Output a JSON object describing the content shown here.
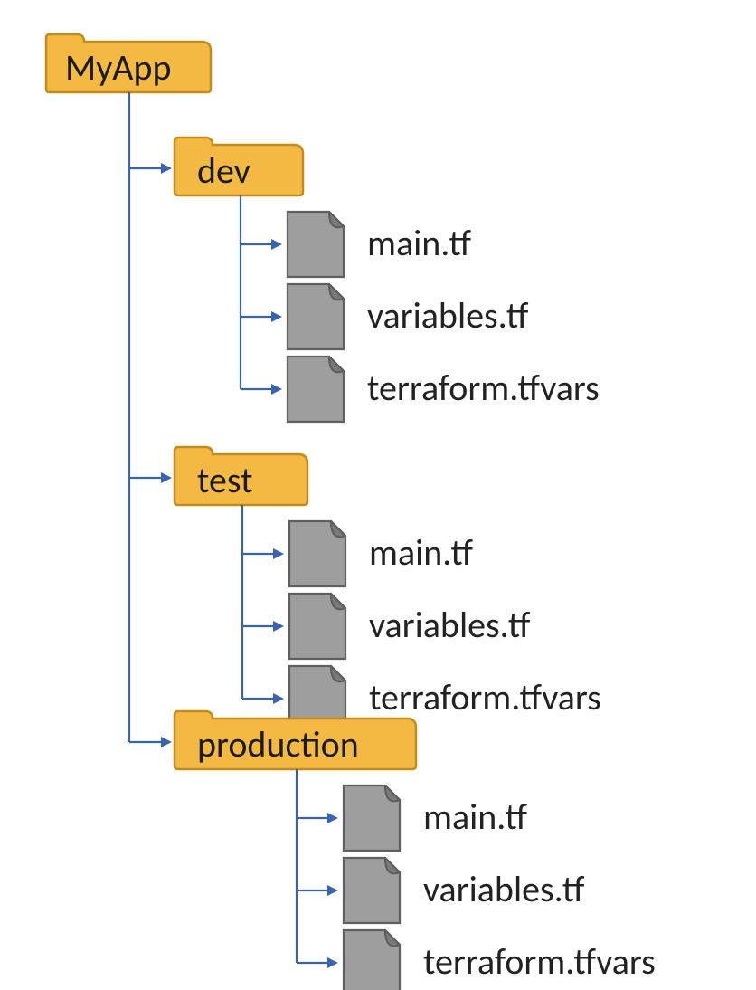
{
  "colors": {
    "folder_fill": "#f4b942",
    "folder_stroke": "#c38b1a",
    "connector": "#3a62b3"
  },
  "tree": {
    "root": {
      "label": "MyApp",
      "type": "folder"
    },
    "children": [
      {
        "label": "dev",
        "type": "folder",
        "files": [
          {
            "label": "main.tf"
          },
          {
            "label": "variables.tf"
          },
          {
            "label": "terraform.tfvars"
          }
        ]
      },
      {
        "label": "test",
        "type": "folder",
        "files": [
          {
            "label": "main.tf"
          },
          {
            "label": "variables.tf"
          },
          {
            "label": "terraform.tfvars"
          }
        ]
      },
      {
        "label": "production",
        "type": "folder",
        "files": [
          {
            "label": "main.tf"
          },
          {
            "label": "variables.tf"
          },
          {
            "label": "terraform.tfvars"
          }
        ]
      }
    ]
  }
}
